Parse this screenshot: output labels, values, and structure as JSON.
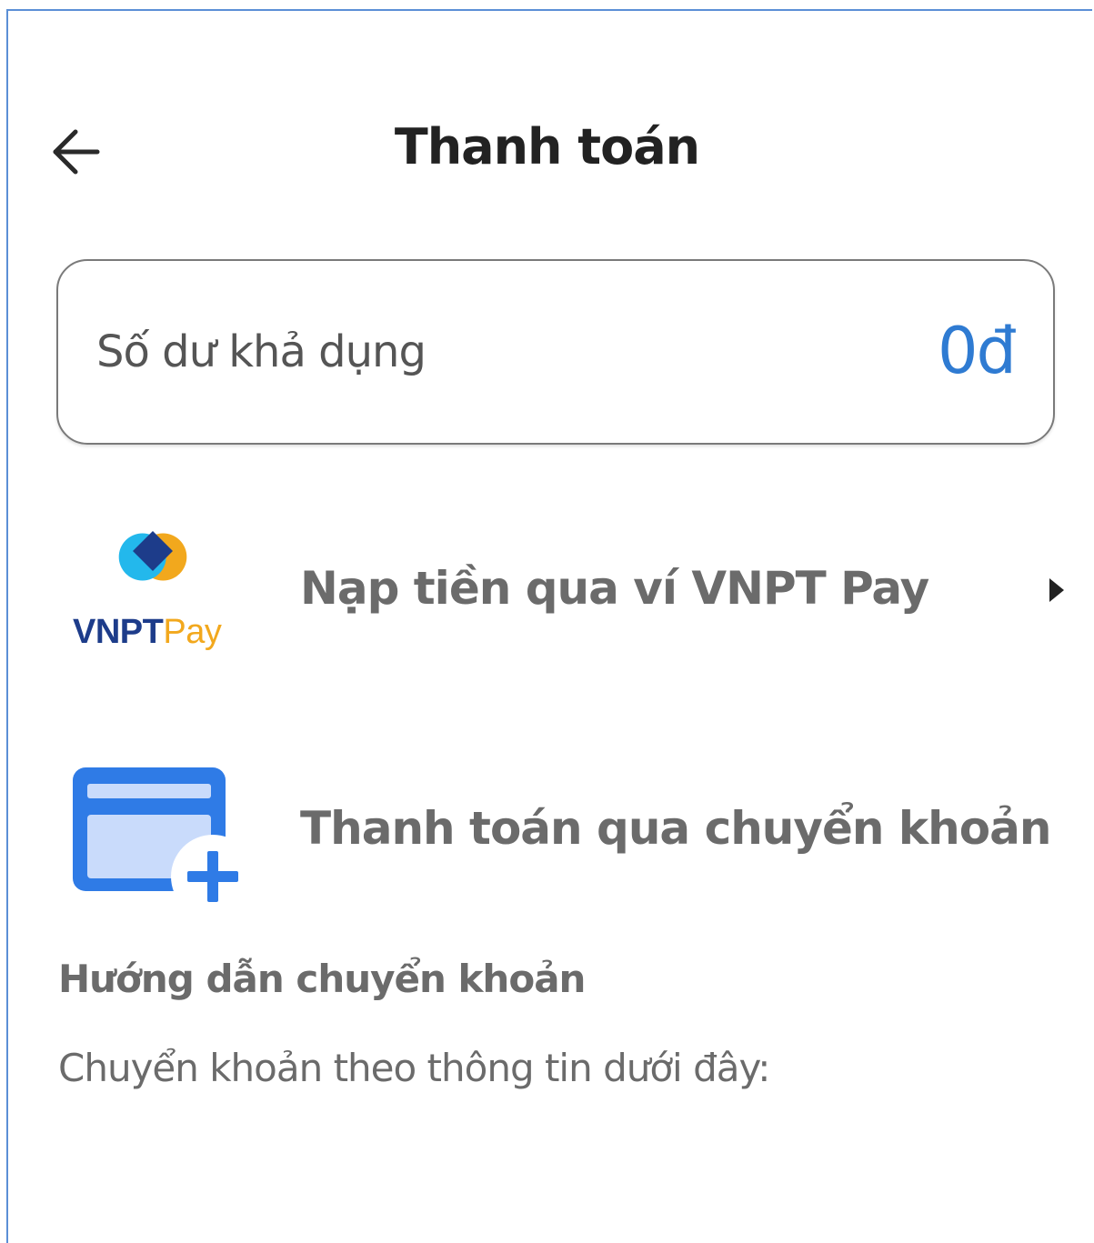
{
  "header": {
    "title": "Thanh toán",
    "back_icon": "arrow-left-icon"
  },
  "balance": {
    "label": "Số dư khả dụng",
    "value": "0đ",
    "value_color": "#2f7bd2"
  },
  "options": [
    {
      "label": "Nạp tiền qua ví VNPT Pay",
      "icon": "vnpt-pay-logo",
      "logo_text_primary": "VNPT",
      "logo_text_secondary": "Pay",
      "trailing_icon": "chevron-right-icon"
    },
    {
      "label": "Thanh toán qua chuyển khoản",
      "icon": "card-add-icon"
    }
  ],
  "guide": {
    "title": "Hướng dẫn chuyển khoản",
    "text": "Chuyển khoản theo thông tin dưới đây:"
  },
  "colors": {
    "accent": "#2f7bd2",
    "vnpt_blue": "#1d3c8a",
    "vnpt_orange": "#f2a81d",
    "vnpt_cyan": "#23b8ec",
    "card_blue": "#2f7be6",
    "card_light": "#c9dbfb"
  }
}
